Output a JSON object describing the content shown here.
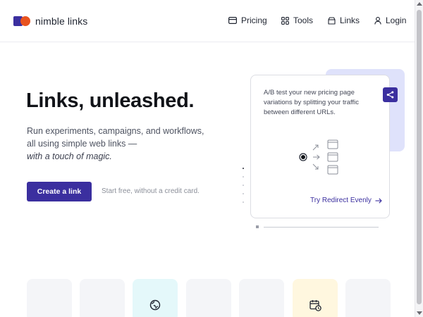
{
  "brand": {
    "name": "nimble links",
    "colors": {
      "primary": "#3b2f9f",
      "accent": "#e8531f"
    }
  },
  "nav": [
    {
      "label": "Pricing",
      "icon": "card-icon"
    },
    {
      "label": "Tools",
      "icon": "grid-icon"
    },
    {
      "label": "Links",
      "icon": "archive-icon"
    },
    {
      "label": "Login",
      "icon": "user-icon"
    }
  ],
  "hero": {
    "title": "Links, unleashed.",
    "subtitle_line1": "Run experiments, campaigns, and workflows,",
    "subtitle_line2": "all using simple web links —",
    "subtitle_line3": "with a touch of magic.",
    "cta": "Create a link",
    "cta_note": "Start free, without a credit card."
  },
  "card": {
    "text": "A/B test your new pricing page variations by splitting your traffic between different URLs.",
    "action_icon": "share-icon",
    "link": "Try Redirect Evenly"
  },
  "tiles": [
    {
      "color": "#f4f5f8"
    },
    {
      "color": "#f4f5f8"
    },
    {
      "color": "#e4f8fa",
      "icon": "globe-icon"
    },
    {
      "color": "#f4f5f8"
    },
    {
      "color": "#f4f5f8"
    },
    {
      "color": "#fff7df",
      "icon": "calendar-clock-icon"
    },
    {
      "color": "#f4f5f8"
    }
  ]
}
